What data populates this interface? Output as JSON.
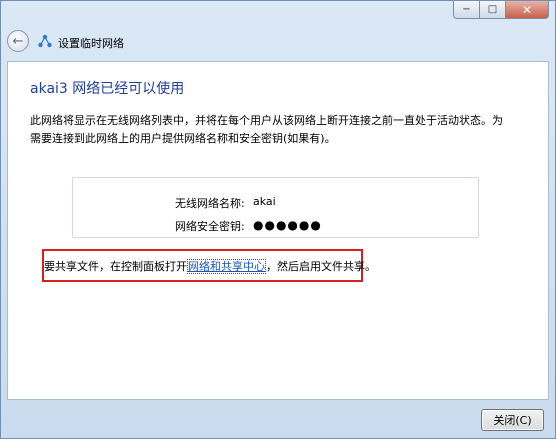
{
  "titlebar": {
    "minimize_glyph": "−",
    "maximize_glyph": "□",
    "close_glyph": "✕"
  },
  "nav": {
    "back_glyph": "←",
    "title": "设置临时网络"
  },
  "content": {
    "heading": "akai3 网络已经可以使用",
    "description": "此网络将显示在无线网络列表中，并将在每个用户从该网络上断开连接之前一直处于活动状态。为需要连接到此网络上的用户提供网络名称和安全密钥(如果有)。",
    "network_name_label": "无线网络名称:",
    "network_name_value": "akai",
    "security_key_label": "网络安全密钥:",
    "security_key_value": "●●●●●●",
    "share_prefix": "要共享文件，在控制面板打开",
    "share_link": "网络和共享中心",
    "share_suffix": "，然后启用文件共享。"
  },
  "footer": {
    "close_label": "关闭(C)"
  },
  "icons": {
    "back": "arrow-left",
    "network": "adhoc-network"
  }
}
